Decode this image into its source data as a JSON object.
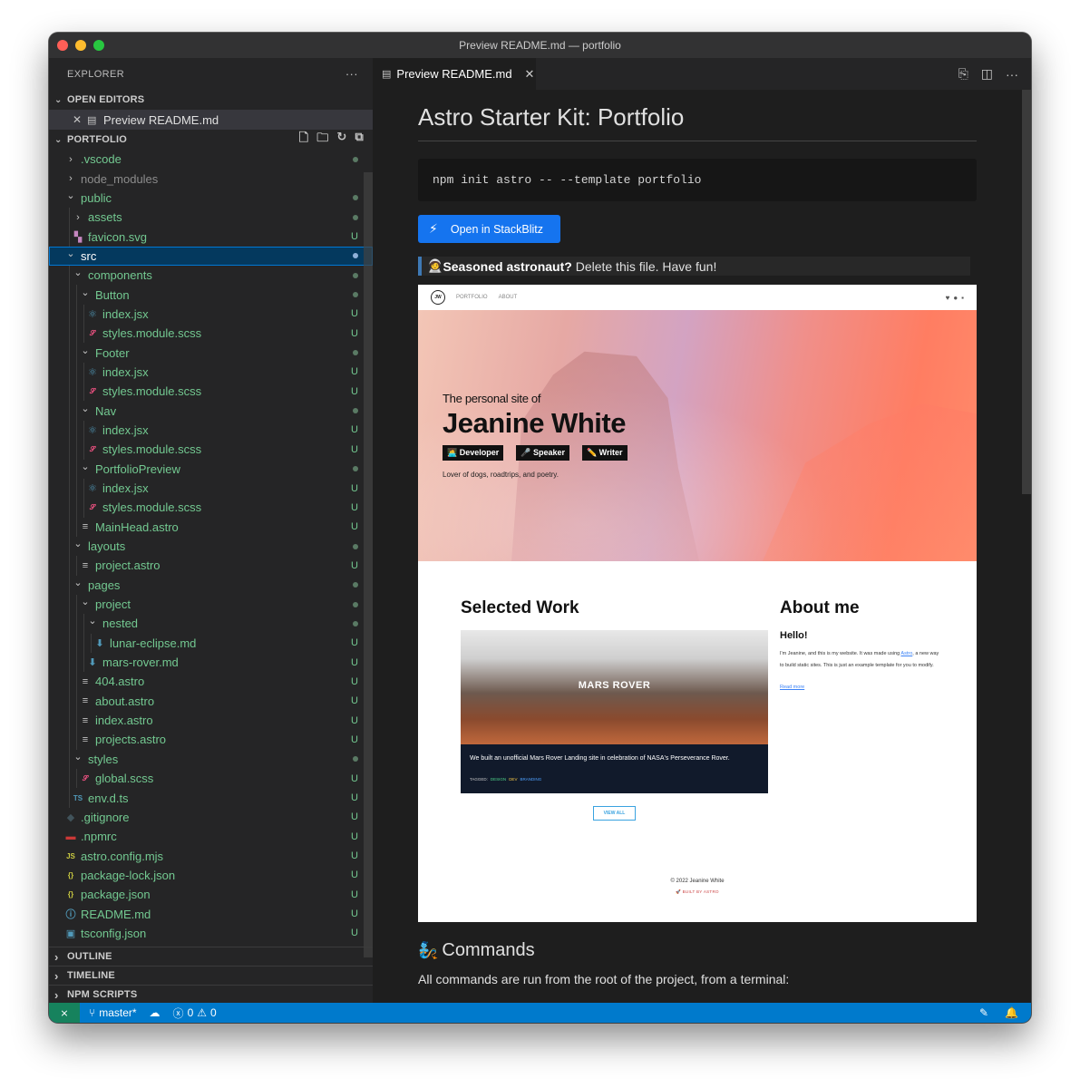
{
  "window": {
    "title": "Preview README.md — portfolio"
  },
  "colors": {
    "accent": "#007acc",
    "git_untracked": "#73c991",
    "selection": "#04395e"
  },
  "explorer": {
    "header": "EXPLORER",
    "more": "···",
    "open_editors": {
      "label": "OPEN EDITORS",
      "items": [
        {
          "label": "Preview README.md"
        }
      ]
    },
    "project": {
      "label": "PORTFOLIO"
    },
    "tree": [
      {
        "label": ".vscode",
        "type": "folder",
        "depth": 0,
        "open": false,
        "status": "dot",
        "ignored": false
      },
      {
        "label": "node_modules",
        "type": "folder",
        "depth": 0,
        "open": false,
        "status": "",
        "ignored": true
      },
      {
        "label": "public",
        "type": "folder",
        "depth": 0,
        "open": true,
        "status": "dot",
        "ignored": false
      },
      {
        "label": "assets",
        "type": "folder",
        "depth": 1,
        "open": false,
        "status": "dot",
        "ignored": false
      },
      {
        "label": "favicon.svg",
        "type": "svg",
        "depth": 1,
        "status": "U",
        "ignored": false
      },
      {
        "label": "src",
        "type": "folder",
        "depth": 0,
        "open": true,
        "status": "dot",
        "ignored": false,
        "selected": true
      },
      {
        "label": "components",
        "type": "folder",
        "depth": 1,
        "open": true,
        "status": "dot",
        "ignored": false
      },
      {
        "label": "Button",
        "type": "folder",
        "depth": 2,
        "open": true,
        "status": "dot",
        "ignored": false
      },
      {
        "label": "index.jsx",
        "type": "jsx",
        "depth": 3,
        "status": "U",
        "ignored": false
      },
      {
        "label": "styles.module.scss",
        "type": "scss",
        "depth": 3,
        "status": "U",
        "ignored": false
      },
      {
        "label": "Footer",
        "type": "folder",
        "depth": 2,
        "open": true,
        "status": "dot",
        "ignored": false
      },
      {
        "label": "index.jsx",
        "type": "jsx",
        "depth": 3,
        "status": "U",
        "ignored": false
      },
      {
        "label": "styles.module.scss",
        "type": "scss",
        "depth": 3,
        "status": "U",
        "ignored": false
      },
      {
        "label": "Nav",
        "type": "folder",
        "depth": 2,
        "open": true,
        "status": "dot",
        "ignored": false
      },
      {
        "label": "index.jsx",
        "type": "jsx",
        "depth": 3,
        "status": "U",
        "ignored": false
      },
      {
        "label": "styles.module.scss",
        "type": "scss",
        "depth": 3,
        "status": "U",
        "ignored": false
      },
      {
        "label": "PortfolioPreview",
        "type": "folder",
        "depth": 2,
        "open": true,
        "status": "dot",
        "ignored": false
      },
      {
        "label": "index.jsx",
        "type": "jsx",
        "depth": 3,
        "status": "U",
        "ignored": false
      },
      {
        "label": "styles.module.scss",
        "type": "scss",
        "depth": 3,
        "status": "U",
        "ignored": false
      },
      {
        "label": "MainHead.astro",
        "type": "astro",
        "depth": 2,
        "status": "U",
        "ignored": false
      },
      {
        "label": "layouts",
        "type": "folder",
        "depth": 1,
        "open": true,
        "status": "dot",
        "ignored": false
      },
      {
        "label": "project.astro",
        "type": "astro",
        "depth": 2,
        "status": "U",
        "ignored": false
      },
      {
        "label": "pages",
        "type": "folder",
        "depth": 1,
        "open": true,
        "status": "dot",
        "ignored": false
      },
      {
        "label": "project",
        "type": "folder",
        "depth": 2,
        "open": true,
        "status": "dot",
        "ignored": false
      },
      {
        "label": "nested",
        "type": "folder",
        "depth": 3,
        "open": true,
        "status": "dot",
        "ignored": false
      },
      {
        "label": "lunar-eclipse.md",
        "type": "md",
        "depth": 4,
        "status": "U",
        "ignored": false
      },
      {
        "label": "mars-rover.md",
        "type": "md",
        "depth": 3,
        "status": "U",
        "ignored": false
      },
      {
        "label": "404.astro",
        "type": "astro",
        "depth": 2,
        "status": "U",
        "ignored": false
      },
      {
        "label": "about.astro",
        "type": "astro",
        "depth": 2,
        "status": "U",
        "ignored": false
      },
      {
        "label": "index.astro",
        "type": "astro",
        "depth": 2,
        "status": "U",
        "ignored": false
      },
      {
        "label": "projects.astro",
        "type": "astro",
        "depth": 2,
        "status": "U",
        "ignored": false
      },
      {
        "label": "styles",
        "type": "folder",
        "depth": 1,
        "open": true,
        "status": "dot",
        "ignored": false
      },
      {
        "label": "global.scss",
        "type": "scss",
        "depth": 2,
        "status": "U",
        "ignored": false
      },
      {
        "label": "env.d.ts",
        "type": "ts",
        "depth": 1,
        "status": "U",
        "ignored": false
      },
      {
        "label": ".gitignore",
        "type": "git",
        "depth": 0,
        "status": "U",
        "ignored": false
      },
      {
        "label": ".npmrc",
        "type": "npm",
        "depth": 0,
        "status": "U",
        "ignored": false
      },
      {
        "label": "astro.config.mjs",
        "type": "js",
        "depth": 0,
        "status": "U",
        "ignored": false
      },
      {
        "label": "package-lock.json",
        "type": "json",
        "depth": 0,
        "status": "U",
        "ignored": false
      },
      {
        "label": "package.json",
        "type": "json",
        "depth": 0,
        "status": "U",
        "ignored": false
      },
      {
        "label": "README.md",
        "type": "info",
        "depth": 0,
        "status": "U",
        "ignored": false
      },
      {
        "label": "tsconfig.json",
        "type": "tsconfig",
        "depth": 0,
        "status": "U",
        "ignored": false
      }
    ],
    "bottom_sections": [
      "OUTLINE",
      "TIMELINE",
      "NPM SCRIPTS"
    ]
  },
  "editor": {
    "tab": {
      "label": "Preview README.md"
    },
    "readme": {
      "title": "Astro Starter Kit: Portfolio",
      "code": "npm init astro -- --template portfolio",
      "stackblitz": "Open in StackBlitz",
      "quote_bold": "Seasoned astronaut?",
      "quote_rest": " Delete this file. Have fun!",
      "quote_emoji": "🧑‍🚀",
      "commands_heading": "Commands",
      "commands_emoji": "🧞",
      "commands_text": "All commands are run from the root of the project, from a terminal:"
    },
    "preview": {
      "logo": "JW",
      "nav": [
        "PORTFOLIO",
        "ABOUT"
      ],
      "hero_sub": "The personal site of",
      "hero_name": "Jeanine White",
      "badges": [
        "👩‍💻 Developer",
        "🎤 Speaker",
        "✏️ Writer"
      ],
      "tagline": "Lover of dogs, roadtrips, and poetry.",
      "work_heading": "Selected Work",
      "card_title": "MARS ROVER",
      "card_desc": "We built an unofficial Mars Rover Landing site in celebration of NASA's Perseverance Rover.",
      "card_tags_label": "TAGGED:",
      "card_tags": [
        "DESIGN",
        "DEV",
        "BRANDING"
      ],
      "view_all": "VIEW ALL",
      "about_heading": "About me",
      "hello": "Hello!",
      "about_p1": "I'm Jeanine, and this is my website. It was made using ",
      "about_link": "Astro",
      "about_p2": ", a new way to build static sites. This is just an example template for you to modify.",
      "read_more": "Read more",
      "footer": "© 2022 Jeanine White",
      "built": "🚀 BUILT BY ASTRO"
    }
  },
  "statusbar": {
    "branch": "master*",
    "errors": "0",
    "warnings": "0"
  }
}
